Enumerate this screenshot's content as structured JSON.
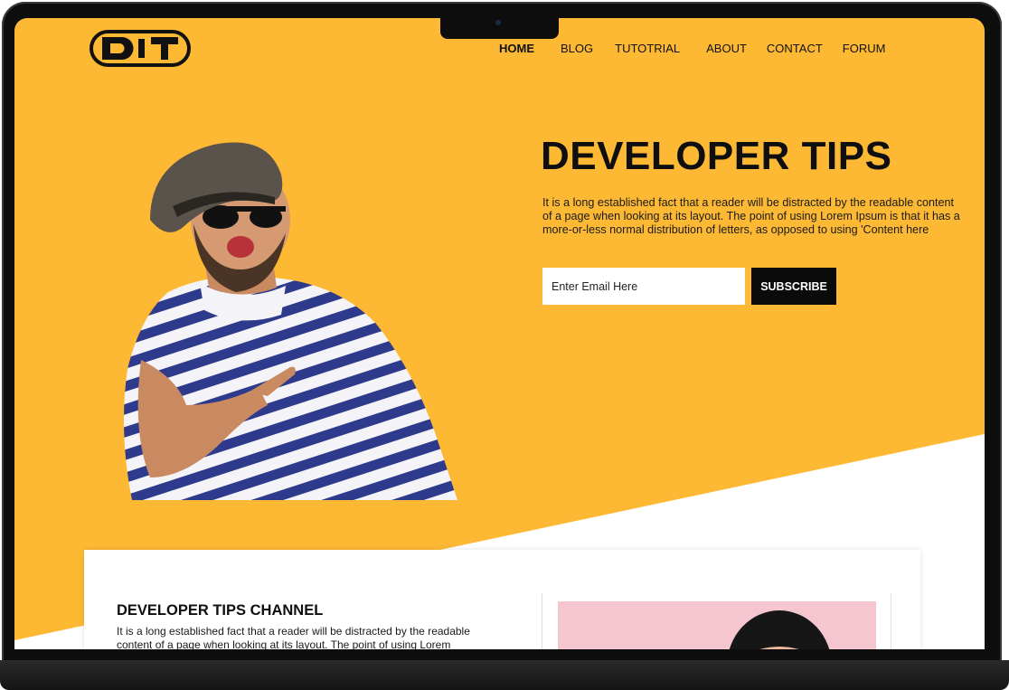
{
  "logo": {
    "text": "DT"
  },
  "nav": {
    "items": [
      {
        "label": "HOME",
        "active": true
      },
      {
        "label": "BLOG",
        "active": false
      },
      {
        "label": "TUTOTRIAL",
        "active": false
      },
      {
        "label": "ABOUT",
        "active": false
      },
      {
        "label": "CONTACT",
        "active": false
      },
      {
        "label": "FORUM",
        "active": false
      }
    ]
  },
  "hero": {
    "title": "DEVELOPER TIPS",
    "text": "It is a long established fact that a reader will be distracted by the readable content of a page when looking at its layout. The point of using Lorem Ipsum is that it has a more-or-less normal distribution of letters, as opposed to using 'Content here",
    "email_placeholder": "Enter Email Here",
    "subscribe_label": "SUBSCRIBE"
  },
  "channel": {
    "title": "DEVELOPER TIPS CHANNEL",
    "text": "It is a long established fact that a reader will be distracted by the readable content of a page when looking at its layout. The point of using Lorem"
  },
  "colors": {
    "accent": "#fdb933",
    "dark": "#0b0b0b",
    "white": "#ffffff",
    "pink": "#f6c6d0"
  },
  "icons": {
    "logo": "dt-logo-icon",
    "camera": "camera-icon"
  }
}
